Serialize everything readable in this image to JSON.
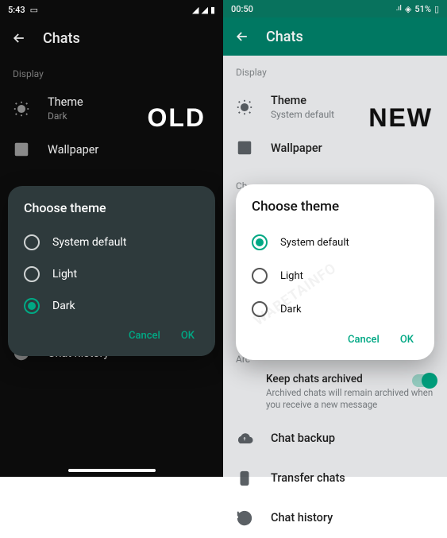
{
  "old": {
    "status": {
      "time": "5:43"
    },
    "appbar": {
      "title": "Chats"
    },
    "label": "OLD",
    "section": "Display",
    "theme": {
      "title": "Theme",
      "value": "Dark"
    },
    "wallpaper": "Wallpaper",
    "chat_history": "Chat history",
    "dialog": {
      "title": "Choose theme",
      "options": [
        "System default",
        "Light",
        "Dark"
      ],
      "selected_index": 2,
      "cancel": "Cancel",
      "ok": "OK"
    }
  },
  "new": {
    "status": {
      "time": "00:50",
      "battery": "51%"
    },
    "appbar": {
      "title": "Chats"
    },
    "label": "NEW",
    "section": "Display",
    "theme": {
      "title": "Theme",
      "value": "System default"
    },
    "wallpaper": "Wallpaper",
    "section2_partial": "Ch",
    "archive_section": "Arc",
    "keep_archived": {
      "title": "Keep chats archived",
      "desc": "Archived chats will remain archived when you receive a new message"
    },
    "chat_backup": "Chat backup",
    "transfer_chats": "Transfer chats",
    "chat_history": "Chat history",
    "dialog": {
      "title": "Choose theme",
      "options": [
        "System default",
        "Light",
        "Dark"
      ],
      "selected_index": 0,
      "cancel": "Cancel",
      "ok": "OK"
    }
  }
}
